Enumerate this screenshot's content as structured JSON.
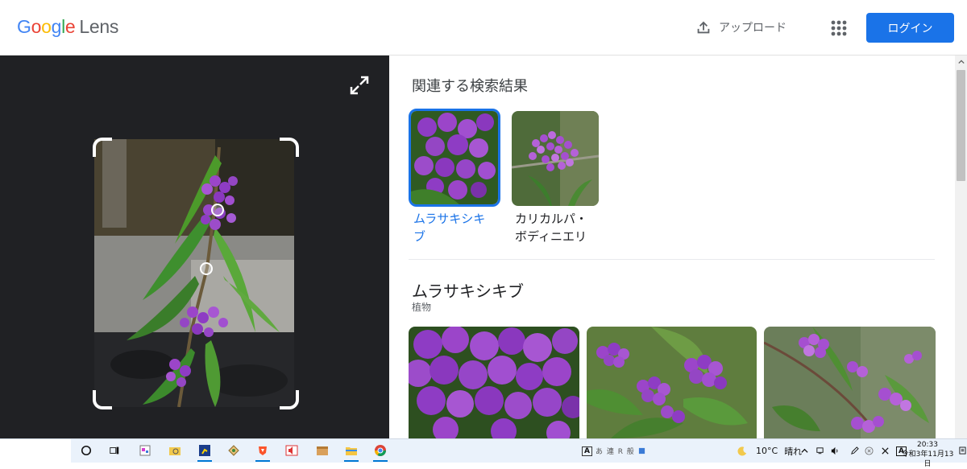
{
  "header": {
    "logo_google": "Google",
    "logo_lens": "Lens",
    "upload_label": "アップロード",
    "apps_icon": "apps-grid-icon",
    "login_label": "ログイン"
  },
  "colors": {
    "accent": "#1a73e8",
    "left_pane_bg": "#202124",
    "berry_purple": "#8e3cc4",
    "leaf_green": "#3e8f2e"
  },
  "left_pane": {
    "expand_icon": "expand-icon"
  },
  "results": {
    "section_title": "関連する検索結果",
    "items": [
      {
        "label": "ムラサキシキブ",
        "selected": true
      },
      {
        "label": "カリカルパ・ボディニエリ",
        "selected": false
      }
    ]
  },
  "entity": {
    "title": "ムラサキシキブ",
    "subtitle": "植物"
  },
  "taskbar": {
    "ime_label": "A",
    "ime_glyphs": "あ 連 R 般",
    "weather_temp": "10°C",
    "weather_text": "晴れ",
    "clock_time": "20:33",
    "clock_date": "令和3年11月13日",
    "tray_a": "A"
  }
}
